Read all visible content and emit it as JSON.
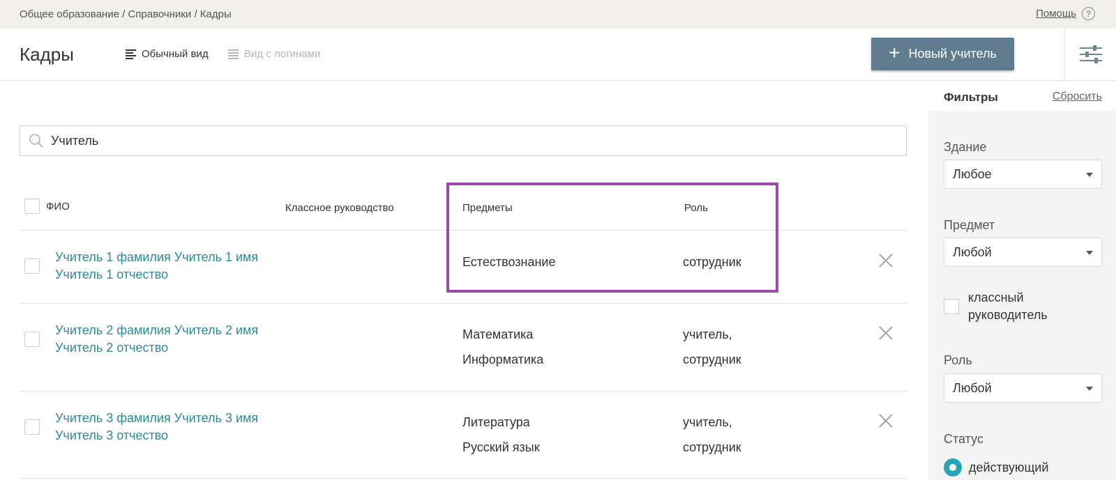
{
  "breadcrumb": "Общее образование / Справочники / Кадры",
  "help": {
    "label": "Помощь",
    "icon_glyph": "?"
  },
  "header": {
    "title": "Кадры",
    "view_normal": "Обычный вид",
    "view_logins": "Вид с логинами",
    "new_teacher": "Новый учитель",
    "new_teacher_icon": "+"
  },
  "search": {
    "value": "Учитель",
    "placeholder": ""
  },
  "table": {
    "columns": {
      "fio": "ФИО",
      "class": "Классное руководство",
      "subjects": "Предметы",
      "role": "Роль"
    },
    "rows": [
      {
        "name_line1": "Учитель 1 фамилия Учитель 1 имя",
        "name_line2": "Учитель 1 отчество",
        "subject1": "Естествознание",
        "subject2": "",
        "role1": "сотрудник",
        "role2": ""
      },
      {
        "name_line1": "Учитель 2 фамилия Учитель 2 имя",
        "name_line2": "Учитель 2 отчество",
        "subject1": "Математика",
        "subject2": "Информатика",
        "role1": "учитель,",
        "role2": "сотрудник"
      },
      {
        "name_line1": "Учитель 3 фамилия Учитель 3 имя",
        "name_line2": "Учитель 3 отчество",
        "subject1": "Литература",
        "subject2": "Русский язык",
        "role1": "учитель,",
        "role2": "сотрудник"
      }
    ]
  },
  "filters": {
    "title": "Фильтры",
    "reset": "Сбросить",
    "building": {
      "label": "Здание",
      "value": "Любое"
    },
    "subject": {
      "label": "Предмет",
      "value": "Любой"
    },
    "class_teacher": {
      "label": "классный руководитель"
    },
    "role": {
      "label": "Роль",
      "value": "Любой"
    },
    "status": {
      "label": "Статус",
      "option": "действующий"
    }
  },
  "colors": {
    "accent": "#2b8a99",
    "button": "#5f7d8e",
    "highlight": "#9c4aa8",
    "radio": "#27a4b5"
  }
}
